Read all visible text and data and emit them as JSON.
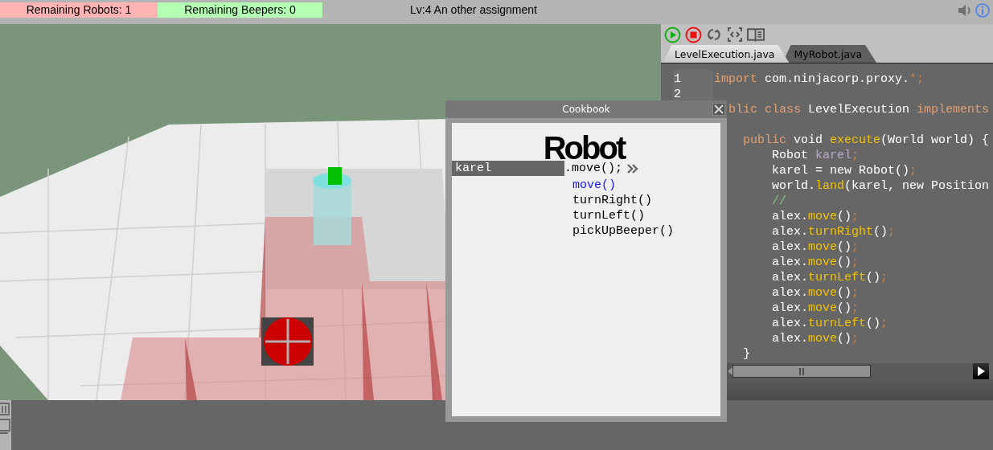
{
  "status_bar": {
    "counters": [
      {
        "text": "Remaining Robots: 1",
        "color": "#ffb4b4"
      },
      {
        "text": "Remaining Beepers: 0",
        "color": "#b4ffb4"
      }
    ],
    "title": "Lv:4 An other assignment"
  },
  "tabs": [
    {
      "label": "LevelExecution.java",
      "selected": true
    },
    {
      "label": "MyRobot.java",
      "selected": false
    }
  ],
  "editor": {
    "lines": [
      {
        "kind": "code",
        "number": "1",
        "segments": [
          {
            "kind": "keyword",
            "text": "import"
          },
          {
            "kind": "plain",
            "text": " com.ninjacorp.proxy."
          },
          {
            "kind": "punct",
            "text": "*;"
          }
        ]
      },
      {
        "kind": "blank",
        "number": "2"
      },
      {
        "kind": "code",
        "segments": [
          {
            "kind": "keyword",
            "text": "  blic class"
          },
          {
            "kind": "plain",
            "text": " LevelExecution "
          },
          {
            "kind": "keyword",
            "text": "implements"
          }
        ]
      },
      {
        "kind": "blank"
      },
      {
        "kind": "code",
        "segments": [
          {
            "kind": "keyword",
            "text": "    public"
          },
          {
            "kind": "plain",
            "text": " void "
          },
          {
            "kind": "method",
            "text": "execute"
          },
          {
            "kind": "plain",
            "text": "(World world) {"
          }
        ]
      },
      {
        "kind": "code",
        "segments": [
          {
            "kind": "plain",
            "text": "        Robot "
          },
          {
            "kind": "variable",
            "text": "karel"
          },
          {
            "kind": "punct",
            "text": ";"
          }
        ]
      },
      {
        "kind": "code",
        "segments": [
          {
            "kind": "plain",
            "text": "        karel = new Robot()"
          },
          {
            "kind": "punct",
            "text": ";"
          }
        ]
      },
      {
        "kind": "code",
        "segments": [
          {
            "kind": "plain",
            "text": "        world."
          },
          {
            "kind": "method",
            "text": "land"
          },
          {
            "kind": "plain",
            "text": "(karel, new Position"
          }
        ]
      },
      {
        "kind": "code",
        "segments": [
          {
            "kind": "comment",
            "text": "        //"
          }
        ]
      },
      {
        "kind": "code",
        "segments": [
          {
            "kind": "plain",
            "text": "        alex."
          },
          {
            "kind": "method",
            "text": "move"
          },
          {
            "kind": "plain",
            "text": "()"
          },
          {
            "kind": "punct",
            "text": ";"
          }
        ]
      },
      {
        "kind": "code",
        "segments": [
          {
            "kind": "plain",
            "text": "        alex."
          },
          {
            "kind": "method",
            "text": "turnRight"
          },
          {
            "kind": "plain",
            "text": "()"
          },
          {
            "kind": "punct",
            "text": ";"
          }
        ]
      },
      {
        "kind": "code",
        "segments": [
          {
            "kind": "plain",
            "text": "        alex."
          },
          {
            "kind": "method",
            "text": "move"
          },
          {
            "kind": "plain",
            "text": "()"
          },
          {
            "kind": "punct",
            "text": ";"
          }
        ]
      },
      {
        "kind": "code",
        "segments": [
          {
            "kind": "plain",
            "text": "        alex."
          },
          {
            "kind": "method",
            "text": "move"
          },
          {
            "kind": "plain",
            "text": "()"
          },
          {
            "kind": "punct",
            "text": ";"
          }
        ]
      },
      {
        "kind": "code",
        "segments": [
          {
            "kind": "plain",
            "text": "        alex."
          },
          {
            "kind": "method",
            "text": "turnLeft"
          },
          {
            "kind": "plain",
            "text": "()"
          },
          {
            "kind": "punct",
            "text": ";"
          }
        ]
      },
      {
        "kind": "code",
        "segments": [
          {
            "kind": "plain",
            "text": "        alex."
          },
          {
            "kind": "method",
            "text": "move"
          },
          {
            "kind": "plain",
            "text": "()"
          },
          {
            "kind": "punct",
            "text": ";"
          }
        ]
      },
      {
        "kind": "code",
        "segments": [
          {
            "kind": "plain",
            "text": "        alex."
          },
          {
            "kind": "method",
            "text": "move"
          },
          {
            "kind": "plain",
            "text": "()"
          },
          {
            "kind": "punct",
            "text": ";"
          }
        ]
      },
      {
        "kind": "code",
        "segments": [
          {
            "kind": "plain",
            "text": "        alex."
          },
          {
            "kind": "method",
            "text": "turnLeft"
          },
          {
            "kind": "plain",
            "text": "()"
          },
          {
            "kind": "punct",
            "text": ";"
          }
        ]
      },
      {
        "kind": "code",
        "segments": [
          {
            "kind": "plain",
            "text": "        alex."
          },
          {
            "kind": "method",
            "text": "move"
          },
          {
            "kind": "plain",
            "text": "()"
          },
          {
            "kind": "punct",
            "text": ";"
          }
        ]
      },
      {
        "kind": "code",
        "segments": [
          {
            "kind": "plain",
            "text": "    }"
          }
        ]
      }
    ]
  },
  "cookbook": {
    "title": "Cookbook",
    "heading": "Robot",
    "variable": "karel",
    "call": ".move();",
    "methods": [
      {
        "label": "move()",
        "selected": true
      },
      {
        "label": "turnRight()",
        "selected": false
      },
      {
        "label": "turnLeft()",
        "selected": false
      },
      {
        "label": "pickUpBeeper()",
        "selected": false
      }
    ]
  }
}
